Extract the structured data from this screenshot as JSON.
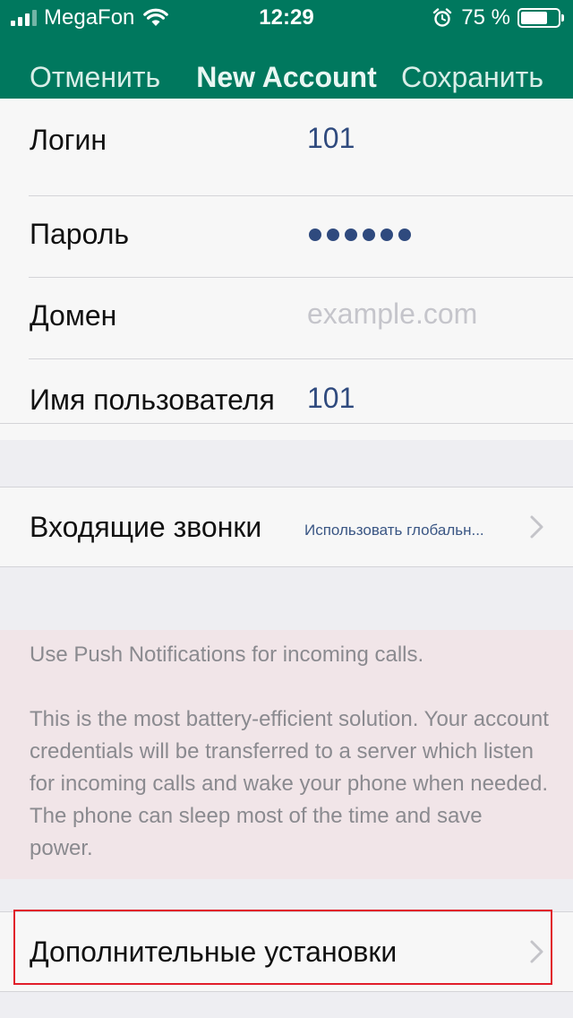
{
  "status_bar": {
    "carrier": "MegaFon",
    "time": "12:29",
    "battery_percent": "75 %",
    "battery_level": 0.75
  },
  "nav": {
    "cancel_label": "Отменить",
    "title": "New Account",
    "save_label": "Сохранить"
  },
  "account": {
    "login_label": "Логин",
    "login_value": "101",
    "password_label": "Пароль",
    "password_length": 6,
    "domain_label": "Домен",
    "domain_placeholder": "example.com",
    "username_label": "Имя пользователя",
    "username_value": "101"
  },
  "incoming": {
    "label": "Входящие звонки",
    "value": "Использовать глобальн..."
  },
  "push_info": {
    "line1": "Use Push Notifications for incoming calls.",
    "line2": "This is the most battery-efficient solution. Your account credentials will be transferred to a server which listen for incoming calls and wake your phone when needed. The phone can sleep most of the time and save power."
  },
  "advanced": {
    "label": "Дополнительные установки"
  },
  "colors": {
    "header": "#00785e",
    "value_text": "#2f4a7e",
    "info_bg": "#f1e5e8",
    "highlight": "#e11d2a"
  }
}
